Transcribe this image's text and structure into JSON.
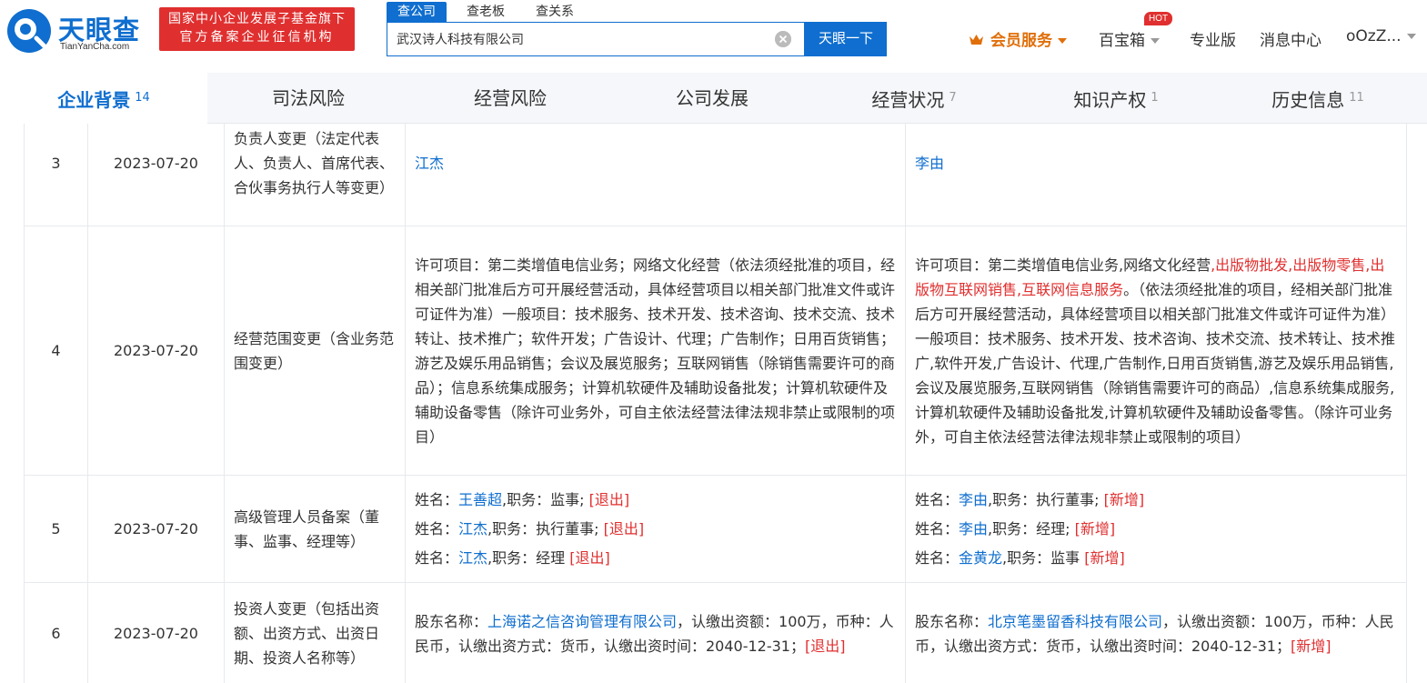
{
  "header": {
    "logo_cn": "天眼查",
    "logo_en": "TianYanCha.com",
    "badge_line1": "国家中小企业发展子基金旗下",
    "badge_line2": "官方备案企业征信机构",
    "search_tabs": [
      "查公司",
      "查老板",
      "查关系"
    ],
    "search_value": "武汉诗人科技有限公司",
    "search_button": "天眼一下",
    "member": "会员服务",
    "toolbox": "百宝箱",
    "hot": "HOT",
    "pro": "专业版",
    "messages": "消息中心",
    "user": "oOzZ..."
  },
  "tabs": [
    {
      "label": "企业背景",
      "count": "14"
    },
    {
      "label": "司法风险",
      "count": ""
    },
    {
      "label": "经营风险",
      "count": ""
    },
    {
      "label": "公司发展",
      "count": ""
    },
    {
      "label": "经营状况",
      "count": "7"
    },
    {
      "label": "知识产权",
      "count": "1"
    },
    {
      "label": "历史信息",
      "count": "11"
    }
  ],
  "rows": {
    "r3": {
      "idx": "3",
      "date": "2023-07-20",
      "item": "负责人变更（法定代表人、负责人、首席代表、合伙事务执行人等变更）",
      "before": "江杰",
      "after": "李由"
    },
    "r4": {
      "idx": "4",
      "date": "2023-07-20",
      "item": "经营范围变更（含业务范围变更）",
      "before": "许可项目：第二类增值电信业务；网络文化经营（依法须经批准的项目，经相关部门批准后方可开展经营活动，具体经营项目以相关部门批准文件或许可证件为准）一般项目：技术服务、技术开发、技术咨询、技术交流、技术转让、技术推广；软件开发；广告设计、代理；广告制作；日用百货销售；游艺及娱乐用品销售；会议及展览服务；互联网销售（除销售需要许可的商品）；信息系统集成服务；计算机软硬件及辅助设备批发；计算机软硬件及辅助设备零售（除许可业务外，可自主依法经营法律法规非禁止或限制的项目）",
      "after_p1": "许可项目：第二类增值电信业务,网络文化经营",
      "after_red": ",出版物批发,出版物零售,出版物互联网销售,互联网信息服务",
      "after_p2": "。（依法须经批准的项目，经相关部门批准后方可开展经营活动，具体经营项目以相关部门批准文件或许可证件为准）一般项目：技术服务、技术开发、技术咨询、技术交流、技术转让、技术推广,软件开发,广告设计、代理,广告制作,日用百货销售,游艺及娱乐用品销售,会议及展览服务,互联网销售（除销售需要许可的商品）,信息系统集成服务,计算机软硬件及辅助设备批发,计算机软硬件及辅助设备零售。（除许可业务外，可自主依法经营法律法规非禁止或限制的项目）"
    },
    "r5": {
      "idx": "5",
      "date": "2023-07-20",
      "item": "高级管理人员备案（董事、监事、经理等）",
      "name_label": "姓名：",
      "role_label": ",职务：",
      "before": [
        {
          "name": "王善超",
          "role": "监事",
          "tag": "[退出]"
        },
        {
          "name": "江杰",
          "role": "执行董事",
          "tag": "[退出]"
        },
        {
          "name": "江杰",
          "role": "经理",
          "tag": "[退出]"
        }
      ],
      "after": [
        {
          "name": "李由",
          "role": "执行董事",
          "tag": "[新增]"
        },
        {
          "name": "李由",
          "role": "经理",
          "tag": "[新增]"
        },
        {
          "name": "金黄龙",
          "role": "监事",
          "tag": "[新增]"
        }
      ]
    },
    "r6": {
      "idx": "6",
      "date": "2023-07-20",
      "item": "投资人变更（包括出资额、出资方式、出资日期、投资人名称等）",
      "label": "股东名称：",
      "detail": "，认缴出资额：100万，币种：人民币，认缴出资方式：货币，认缴出资时间：2040-12-31；",
      "before_name": "上海诺之信咨询管理有限公司",
      "before_tag": "[退出]",
      "after_name": "北京笔墨留香科技有限公司",
      "after_tag": "[新增]"
    }
  },
  "colors": {
    "brand": "#0f6ecf",
    "red": "#e02f2f",
    "member": "#e06f0a"
  }
}
